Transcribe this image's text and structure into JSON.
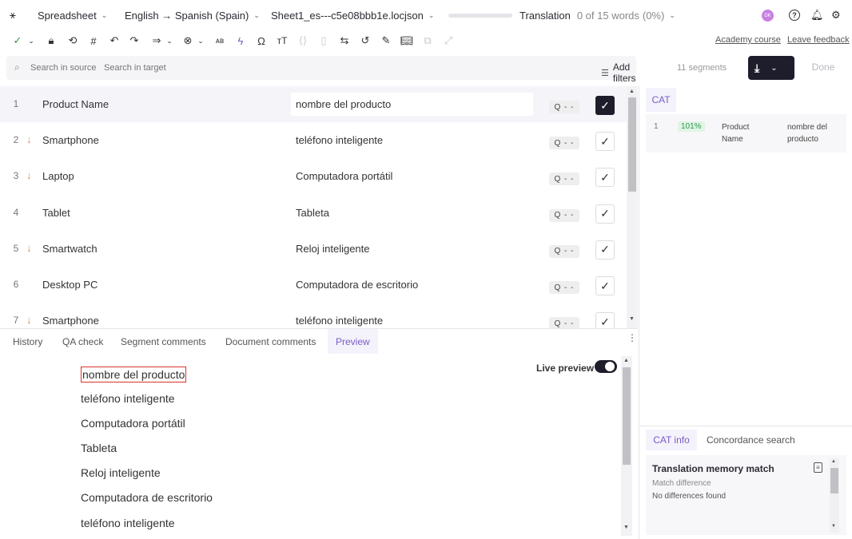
{
  "topbar": {
    "view_label": "Spreadsheet",
    "language_pair": "English → Spanish (Spain)",
    "file_name": "Sheet1_es---c5e08bbb1e.locjson",
    "mode_label": "Translation",
    "word_progress": "0 of 15 words",
    "percent": "(0%)",
    "progress_fraction": 0,
    "avatar_initials": "DK"
  },
  "toolbar": {
    "academy_course": "Academy course",
    "leave_feedback": "Leave feedback"
  },
  "search": {
    "source_placeholder": "Search in source",
    "target_placeholder": "Search in target",
    "add_filters": "Add filters",
    "segment_count": "11 segments",
    "done_label": "Done"
  },
  "segments": [
    {
      "num": "1",
      "arrow": "",
      "source": "Product Name",
      "target": "nombre del producto",
      "qa": "Q - -",
      "confirmed": true
    },
    {
      "num": "2",
      "arrow": "↓",
      "source": "Smartphone",
      "target": "teléfono inteligente",
      "qa": "Q - -",
      "confirmed": false
    },
    {
      "num": "3",
      "arrow": "↓",
      "source": "Laptop",
      "target": "Computadora portátil",
      "qa": "Q - -",
      "confirmed": false
    },
    {
      "num": "4",
      "arrow": "",
      "source": "Tablet",
      "target": "Tableta",
      "qa": "Q - -",
      "confirmed": false
    },
    {
      "num": "5",
      "arrow": "↓",
      "source": "Smartwatch",
      "target": "Reloj inteligente",
      "qa": "Q - -",
      "confirmed": false
    },
    {
      "num": "6",
      "arrow": "",
      "source": "Desktop PC",
      "target": "Computadora de escritorio",
      "qa": "Q - -",
      "confirmed": false
    },
    {
      "num": "7",
      "arrow": "↓",
      "source": "Smartphone",
      "target": "teléfono inteligente",
      "qa": "Q - -",
      "confirmed": false
    }
  ],
  "bottom_tabs": {
    "history": "History",
    "qa_check": "QA check",
    "segment_comments": "Segment comments",
    "document_comments": "Document comments",
    "preview": "Preview"
  },
  "preview": {
    "live_preview_label": "Live preview",
    "live_preview_on": true,
    "lines": [
      "nombre del producto",
      "teléfono inteligente",
      "Computadora portátil",
      "Tableta",
      "Reloj inteligente",
      "Computadora de escritorio",
      "teléfono inteligente"
    ]
  },
  "cat": {
    "header": "CAT",
    "match": {
      "num": "1",
      "score": "101%",
      "source": "Product Name",
      "target": "nombre del producto"
    },
    "tab_info": "CAT info",
    "tab_concordance": "Concordance search",
    "tm_title": "Translation memory match",
    "match_difference_label": "Match difference",
    "no_differences": "No differences found"
  },
  "colors": {
    "accent_purple": "#7a5cc7",
    "dark_button": "#1e1d2b",
    "arrow_orange": "#e8875a",
    "match_green": "#2e9a4e",
    "avatar": "#c97fe0"
  }
}
